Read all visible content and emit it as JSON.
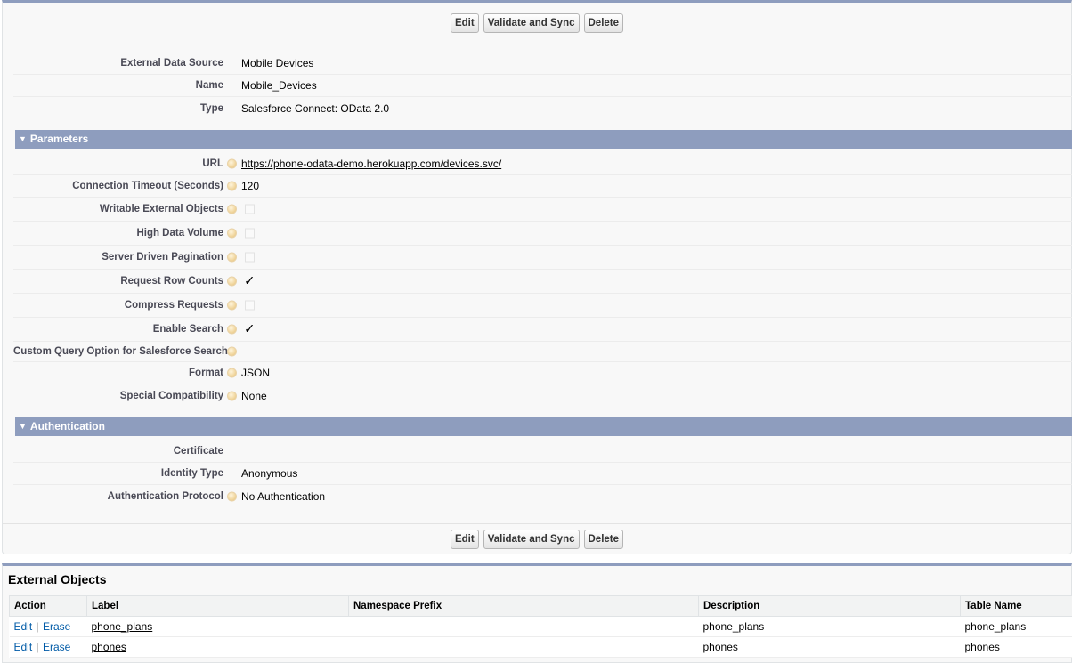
{
  "buttons": {
    "edit": "Edit",
    "validate_sync": "Validate and Sync",
    "delete": "Delete"
  },
  "details": {
    "external_data_source": {
      "label": "External Data Source",
      "value": "Mobile Devices"
    },
    "name": {
      "label": "Name",
      "value": "Mobile_Devices"
    },
    "type": {
      "label": "Type",
      "value": "Salesforce Connect: OData 2.0"
    }
  },
  "parameters": {
    "title": "Parameters",
    "url": {
      "label": "URL",
      "value": "https://phone-odata-demo.herokuapp.com/devices.svc/"
    },
    "connection_timeout": {
      "label": "Connection Timeout (Seconds)",
      "value": "120"
    },
    "writable_external_objects": {
      "label": "Writable External Objects",
      "checked": false
    },
    "high_data_volume": {
      "label": "High Data Volume",
      "checked": false
    },
    "server_driven_pagination": {
      "label": "Server Driven Pagination",
      "checked": false
    },
    "request_row_counts": {
      "label": "Request Row Counts",
      "checked": true
    },
    "compress_requests": {
      "label": "Compress Requests",
      "checked": false
    },
    "enable_search": {
      "label": "Enable Search",
      "checked": true
    },
    "custom_query_option": {
      "label": "Custom Query Option for Salesforce Search",
      "value": ""
    },
    "format": {
      "label": "Format",
      "value": "JSON"
    },
    "special_compatibility": {
      "label": "Special Compatibility",
      "value": "None"
    }
  },
  "authentication": {
    "title": "Authentication",
    "certificate": {
      "label": "Certificate",
      "value": ""
    },
    "identity_type": {
      "label": "Identity Type",
      "value": "Anonymous"
    },
    "authentication_protocol": {
      "label": "Authentication Protocol",
      "value": "No Authentication"
    }
  },
  "external_objects": {
    "title": "External Objects",
    "columns": [
      "Action",
      "Label",
      "Namespace Prefix",
      "Description",
      "Table Name"
    ],
    "action_edit": "Edit",
    "action_erase": "Erase",
    "rows": [
      {
        "label": "phone_plans",
        "namespace_prefix": "",
        "description": "phone_plans",
        "table_name": "phone_plans"
      },
      {
        "label": "phones",
        "namespace_prefix": "",
        "description": "phones",
        "table_name": "phones"
      }
    ]
  },
  "colors": {
    "section_header": "#8e9dbe",
    "link": "#015ba7"
  },
  "icons": {
    "help": "help-icon",
    "collapse": "triangle-down-icon",
    "checkmark": "checkmark-icon"
  }
}
